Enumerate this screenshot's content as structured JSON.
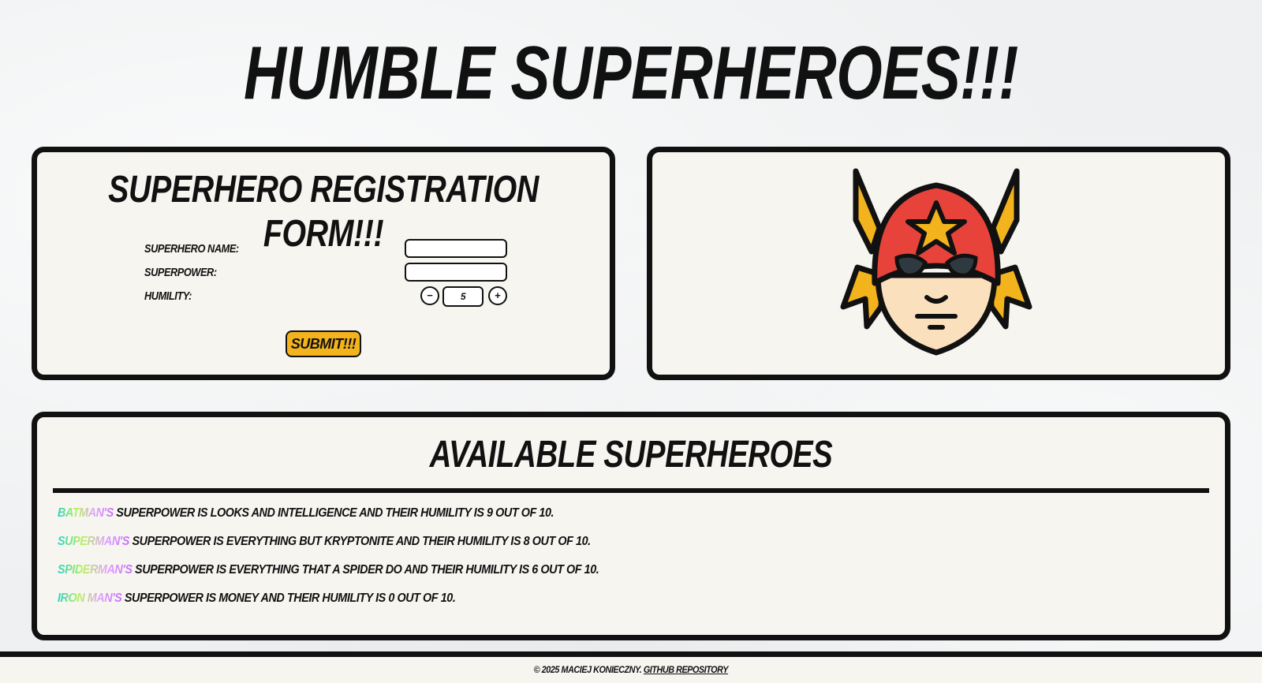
{
  "page": {
    "title": "HUMBLE SUPERHEROES!!!"
  },
  "form": {
    "title": "SUPERHERO REGISTRATION FORM!!!",
    "name_label": "SUPERHERO NAME:",
    "name_value": "",
    "power_label": "SUPERPOWER:",
    "power_value": "",
    "humility_label": "HUMILITY:",
    "humility_value": "5",
    "decrement_symbol": "−",
    "increment_symbol": "+",
    "submit_label": "SUBMIT!!!"
  },
  "image": {
    "icon": "superhero-mask-icon",
    "colors": {
      "helmet": "#e8433a",
      "wings": "#f2b31d",
      "skin": "#fbe0bd",
      "outline": "#111111"
    }
  },
  "list": {
    "title": "AVAILABLE SUPERHEROES",
    "heroes": [
      {
        "name": "BATMAN'S",
        "text": " SUPERPOWER IS LOOKS AND INTELLIGENCE AND THEIR HUMILITY IS 9 OUT OF 10."
      },
      {
        "name": "SUPERMAN'S",
        "text": " SUPERPOWER IS EVERYTHING BUT KRYPTONITE AND THEIR HUMILITY IS 8 OUT OF 10."
      },
      {
        "name": "SPIDERMAN'S",
        "text": " SUPERPOWER IS EVERYTHING THAT A SPIDER DO AND THEIR HUMILITY IS 6 OUT OF 10."
      },
      {
        "name": "IRON MAN'S",
        "text": " SUPERPOWER IS MONEY AND THEIR HUMILITY IS 0 OUT OF 10."
      }
    ]
  },
  "footer": {
    "copyright": "© 2025 MACIEJ KONIECZNY. ",
    "link_label": "GITHUB REPOSITORY"
  },
  "colors": {
    "accent": "#f2b31d",
    "panel_bg": "#f7f5f0",
    "border": "#111111"
  }
}
